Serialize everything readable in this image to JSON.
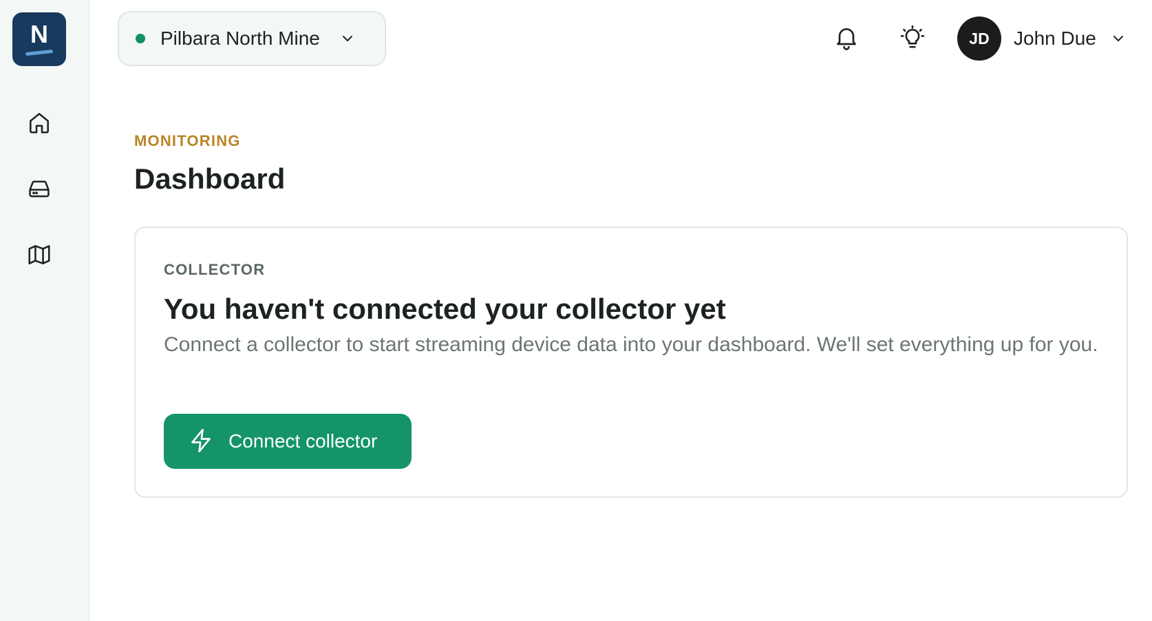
{
  "brand": {
    "logo_letter": "N",
    "colors": {
      "logo_bg": "#173a5e",
      "accent": "#149468",
      "eyebrow": "#b98525"
    }
  },
  "sidebar": {
    "items": [
      {
        "icon": "home-icon"
      },
      {
        "icon": "storage-drive-icon"
      },
      {
        "icon": "map-icon"
      }
    ]
  },
  "header": {
    "site": {
      "name": "Pilbara North Mine",
      "status_color": "#139066",
      "icon": "chevron-down-icon"
    },
    "notifications_icon": "bell-icon",
    "tips_icon": "lightbulb-icon",
    "user": {
      "initials": "JD",
      "name": "John Due",
      "icon": "chevron-down-icon"
    }
  },
  "page": {
    "eyebrow": "MONITORING",
    "title": "Dashboard"
  },
  "collector_card": {
    "eyebrow": "COLLECTOR",
    "title": "You haven't connected your collector yet",
    "description": "Connect a collector to start streaming device data into your dashboard. We'll set everything up for you.",
    "button_label": "Connect collector",
    "button_icon": "lightning-bolt-icon"
  }
}
